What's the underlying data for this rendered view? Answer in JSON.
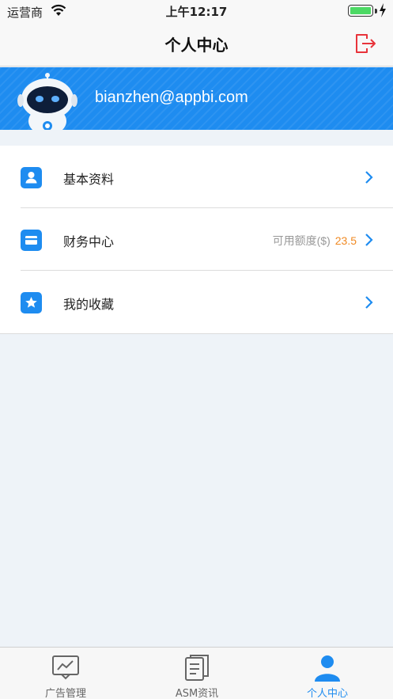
{
  "status_bar": {
    "carrier": "运营商",
    "time": "上午12:17",
    "battery_level": 1.0
  },
  "nav": {
    "title": "个人中心",
    "logout_icon": "logout-icon"
  },
  "profile": {
    "email": "bianzhen@appbi.com",
    "avatar_icon": "robot-avatar"
  },
  "menu": {
    "items": [
      {
        "label": "基本资料",
        "icon": "user-icon"
      },
      {
        "label": "财务中心",
        "icon": "card-icon",
        "extra_label": "可用额度($)",
        "extra_value": "23.5"
      },
      {
        "label": "我的收藏",
        "icon": "star-icon"
      }
    ]
  },
  "tabbar": {
    "tabs": [
      {
        "label": "广告管理",
        "icon": "presentation-icon",
        "active": false
      },
      {
        "label": "ASM资讯",
        "icon": "document-icon",
        "active": false
      },
      {
        "label": "个人中心",
        "icon": "person-icon",
        "active": true
      }
    ]
  },
  "colors": {
    "accent": "#1e8cf0",
    "highlight_value": "#f08a24",
    "logout": "#e8333a"
  }
}
